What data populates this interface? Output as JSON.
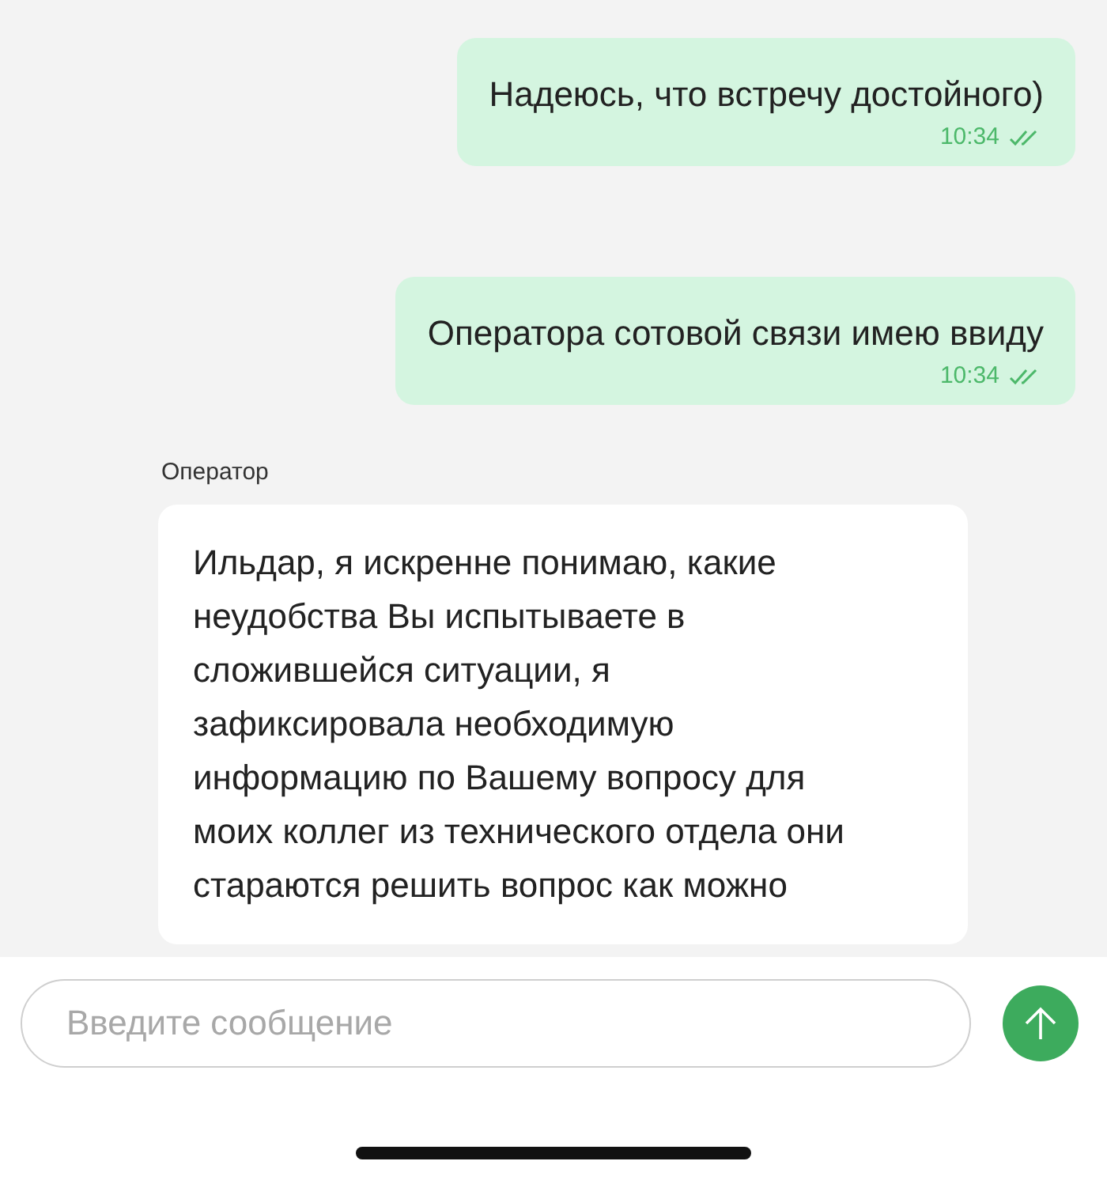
{
  "messages": [
    {
      "kind": "outgoing",
      "text": "Надеюсь, что встречу достойного)",
      "time": "10:34",
      "read": true
    },
    {
      "kind": "outgoing",
      "text": "Оператора сотовой связи имею ввиду",
      "time": "10:34",
      "read": true
    },
    {
      "kind": "incoming",
      "sender": "Оператор",
      "text": "Ильдар, я искренне понимаю, какие\nнеудобства Вы испытываете в\nсложившейся ситуации, я\nзафиксировала необходимую\nинформацию по Вашему вопросу для\nмоих коллег из технического отдела они\nстараются решить вопрос как можно"
    }
  ],
  "composer": {
    "placeholder": "Введите сообщение"
  }
}
